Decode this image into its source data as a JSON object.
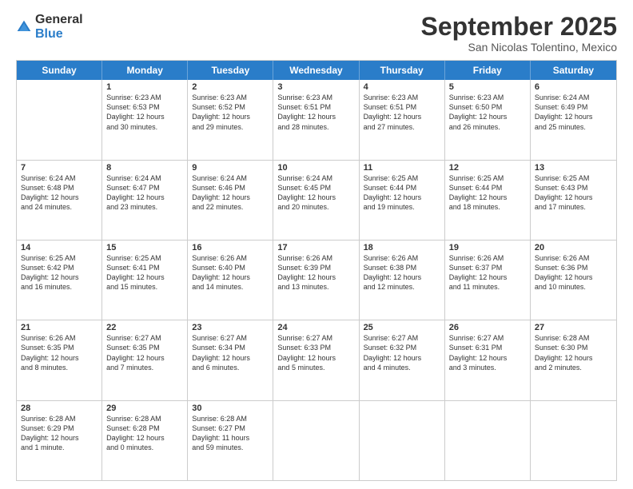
{
  "logo": {
    "general": "General",
    "blue": "Blue"
  },
  "title": "September 2025",
  "location": "San Nicolas Tolentino, Mexico",
  "header_days": [
    "Sunday",
    "Monday",
    "Tuesday",
    "Wednesday",
    "Thursday",
    "Friday",
    "Saturday"
  ],
  "weeks": [
    [
      {
        "day": "",
        "info": ""
      },
      {
        "day": "1",
        "info": "Sunrise: 6:23 AM\nSunset: 6:53 PM\nDaylight: 12 hours\nand 30 minutes."
      },
      {
        "day": "2",
        "info": "Sunrise: 6:23 AM\nSunset: 6:52 PM\nDaylight: 12 hours\nand 29 minutes."
      },
      {
        "day": "3",
        "info": "Sunrise: 6:23 AM\nSunset: 6:51 PM\nDaylight: 12 hours\nand 28 minutes."
      },
      {
        "day": "4",
        "info": "Sunrise: 6:23 AM\nSunset: 6:51 PM\nDaylight: 12 hours\nand 27 minutes."
      },
      {
        "day": "5",
        "info": "Sunrise: 6:23 AM\nSunset: 6:50 PM\nDaylight: 12 hours\nand 26 minutes."
      },
      {
        "day": "6",
        "info": "Sunrise: 6:24 AM\nSunset: 6:49 PM\nDaylight: 12 hours\nand 25 minutes."
      }
    ],
    [
      {
        "day": "7",
        "info": "Sunrise: 6:24 AM\nSunset: 6:48 PM\nDaylight: 12 hours\nand 24 minutes."
      },
      {
        "day": "8",
        "info": "Sunrise: 6:24 AM\nSunset: 6:47 PM\nDaylight: 12 hours\nand 23 minutes."
      },
      {
        "day": "9",
        "info": "Sunrise: 6:24 AM\nSunset: 6:46 PM\nDaylight: 12 hours\nand 22 minutes."
      },
      {
        "day": "10",
        "info": "Sunrise: 6:24 AM\nSunset: 6:45 PM\nDaylight: 12 hours\nand 20 minutes."
      },
      {
        "day": "11",
        "info": "Sunrise: 6:25 AM\nSunset: 6:44 PM\nDaylight: 12 hours\nand 19 minutes."
      },
      {
        "day": "12",
        "info": "Sunrise: 6:25 AM\nSunset: 6:44 PM\nDaylight: 12 hours\nand 18 minutes."
      },
      {
        "day": "13",
        "info": "Sunrise: 6:25 AM\nSunset: 6:43 PM\nDaylight: 12 hours\nand 17 minutes."
      }
    ],
    [
      {
        "day": "14",
        "info": "Sunrise: 6:25 AM\nSunset: 6:42 PM\nDaylight: 12 hours\nand 16 minutes."
      },
      {
        "day": "15",
        "info": "Sunrise: 6:25 AM\nSunset: 6:41 PM\nDaylight: 12 hours\nand 15 minutes."
      },
      {
        "day": "16",
        "info": "Sunrise: 6:26 AM\nSunset: 6:40 PM\nDaylight: 12 hours\nand 14 minutes."
      },
      {
        "day": "17",
        "info": "Sunrise: 6:26 AM\nSunset: 6:39 PM\nDaylight: 12 hours\nand 13 minutes."
      },
      {
        "day": "18",
        "info": "Sunrise: 6:26 AM\nSunset: 6:38 PM\nDaylight: 12 hours\nand 12 minutes."
      },
      {
        "day": "19",
        "info": "Sunrise: 6:26 AM\nSunset: 6:37 PM\nDaylight: 12 hours\nand 11 minutes."
      },
      {
        "day": "20",
        "info": "Sunrise: 6:26 AM\nSunset: 6:36 PM\nDaylight: 12 hours\nand 10 minutes."
      }
    ],
    [
      {
        "day": "21",
        "info": "Sunrise: 6:26 AM\nSunset: 6:35 PM\nDaylight: 12 hours\nand 8 minutes."
      },
      {
        "day": "22",
        "info": "Sunrise: 6:27 AM\nSunset: 6:35 PM\nDaylight: 12 hours\nand 7 minutes."
      },
      {
        "day": "23",
        "info": "Sunrise: 6:27 AM\nSunset: 6:34 PM\nDaylight: 12 hours\nand 6 minutes."
      },
      {
        "day": "24",
        "info": "Sunrise: 6:27 AM\nSunset: 6:33 PM\nDaylight: 12 hours\nand 5 minutes."
      },
      {
        "day": "25",
        "info": "Sunrise: 6:27 AM\nSunset: 6:32 PM\nDaylight: 12 hours\nand 4 minutes."
      },
      {
        "day": "26",
        "info": "Sunrise: 6:27 AM\nSunset: 6:31 PM\nDaylight: 12 hours\nand 3 minutes."
      },
      {
        "day": "27",
        "info": "Sunrise: 6:28 AM\nSunset: 6:30 PM\nDaylight: 12 hours\nand 2 minutes."
      }
    ],
    [
      {
        "day": "28",
        "info": "Sunrise: 6:28 AM\nSunset: 6:29 PM\nDaylight: 12 hours\nand 1 minute."
      },
      {
        "day": "29",
        "info": "Sunrise: 6:28 AM\nSunset: 6:28 PM\nDaylight: 12 hours\nand 0 minutes."
      },
      {
        "day": "30",
        "info": "Sunrise: 6:28 AM\nSunset: 6:27 PM\nDaylight: 11 hours\nand 59 minutes."
      },
      {
        "day": "",
        "info": ""
      },
      {
        "day": "",
        "info": ""
      },
      {
        "day": "",
        "info": ""
      },
      {
        "day": "",
        "info": ""
      }
    ]
  ]
}
